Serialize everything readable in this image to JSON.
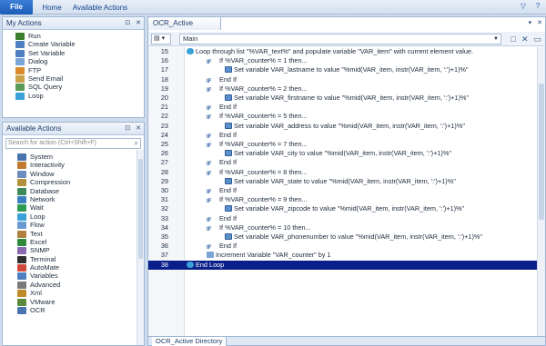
{
  "ribbon": {
    "tabs": [
      "File",
      "Home",
      "Available Actions"
    ],
    "right_icons": [
      "chevron-down-icon",
      "help-icon"
    ]
  },
  "my_actions": {
    "title": "My Actions",
    "items": [
      {
        "label": "Run",
        "icon": "run-icon",
        "color": "#3a7f2e"
      },
      {
        "label": "Create Variable",
        "icon": "create-variable-icon",
        "color": "#4f7fc0"
      },
      {
        "label": "Set Variable",
        "icon": "set-variable-icon",
        "color": "#4f7fc0"
      },
      {
        "label": "Dialog",
        "icon": "dialog-icon",
        "color": "#7aa6d6"
      },
      {
        "label": "FTP",
        "icon": "ftp-icon",
        "color": "#d98a2a"
      },
      {
        "label": "Send Email",
        "icon": "email-icon",
        "color": "#c9a24a"
      },
      {
        "label": "SQL Query",
        "icon": "sql-icon",
        "color": "#5c9a5c"
      },
      {
        "label": "Loop",
        "icon": "loop-icon",
        "color": "#3aa2d8"
      }
    ]
  },
  "available_actions": {
    "title": "Available Actions",
    "search_placeholder": "Search for action (Ctrl+Shift+F)",
    "items": [
      {
        "label": "System",
        "icon": "system-icon",
        "color": "#4a74b0"
      },
      {
        "label": "Interactivity",
        "icon": "interactivity-icon",
        "color": "#c27a2e"
      },
      {
        "label": "Window",
        "icon": "window-icon",
        "color": "#6c8cbf"
      },
      {
        "label": "Compression",
        "icon": "compression-icon",
        "color": "#b2913e"
      },
      {
        "label": "Database",
        "icon": "database-icon",
        "color": "#3f8a5a"
      },
      {
        "label": "Network",
        "icon": "network-icon",
        "color": "#3c7fc0"
      },
      {
        "label": "Wait",
        "icon": "wait-icon",
        "color": "#2e9a54"
      },
      {
        "label": "Loop",
        "icon": "loop-icon",
        "color": "#3aa2d8"
      },
      {
        "label": "Flow",
        "icon": "flow-icon",
        "color": "#6a9bd0"
      },
      {
        "label": "Text",
        "icon": "text-icon",
        "color": "#b08040"
      },
      {
        "label": "Excel",
        "icon": "excel-icon",
        "color": "#2f8a3a"
      },
      {
        "label": "SNMP",
        "icon": "snmp-icon",
        "color": "#8a6ab0"
      },
      {
        "label": "Terminal",
        "icon": "terminal-icon",
        "color": "#303030"
      },
      {
        "label": "AutoMate",
        "icon": "automate-icon",
        "color": "#d04a3a"
      },
      {
        "label": "Variables",
        "icon": "variables-icon",
        "color": "#4f7fc0"
      },
      {
        "label": "Advanced",
        "icon": "advanced-icon",
        "color": "#7a7a7a"
      },
      {
        "label": "Xml",
        "icon": "xml-icon",
        "color": "#c08a2a"
      },
      {
        "label": "VMware",
        "icon": "vmware-icon",
        "color": "#5a8a3a"
      },
      {
        "label": "OCR",
        "icon": "ocr-icon",
        "color": "#4a74b0"
      }
    ]
  },
  "editor": {
    "doc_tab": "OCR_Active Directory",
    "task_select": "Main",
    "bottom_tab": "OCR_Active Directory",
    "selected_color": "#0a1f8a",
    "rows": [
      {
        "num": "15",
        "indent": 0,
        "icon": "loop",
        "text": "Loop through list \"%VAR_text%\" and populate variable \"VAR_item\" with current element value."
      },
      {
        "num": "16",
        "indent": 1,
        "icon": "if",
        "text": "If %VAR_counter% = 1 then..."
      },
      {
        "num": "17",
        "indent": 2,
        "icon": "set",
        "text": "Set variable VAR_lastname to value \"%mid(VAR_item, instr(VAR_item, ':')+1)%\""
      },
      {
        "num": "18",
        "indent": 1,
        "icon": "if",
        "text": "End If"
      },
      {
        "num": "19",
        "indent": 1,
        "icon": "if",
        "text": "If %VAR_counter% = 2 then..."
      },
      {
        "num": "20",
        "indent": 2,
        "icon": "set",
        "text": "Set variable VAR_firstname to value \"%mid(VAR_item, instr(VAR_item, ':')+1)%\""
      },
      {
        "num": "21",
        "indent": 1,
        "icon": "if",
        "text": "End If"
      },
      {
        "num": "22",
        "indent": 1,
        "icon": "if",
        "text": "If %VAR_counter% = 5 then..."
      },
      {
        "num": "23",
        "indent": 2,
        "icon": "set",
        "text": "Set variable VAR_address to value \"%mid(VAR_item, instr(VAR_item, ':')+1)%\""
      },
      {
        "num": "24",
        "indent": 1,
        "icon": "if",
        "text": "End If"
      },
      {
        "num": "25",
        "indent": 1,
        "icon": "if",
        "text": "If %VAR_counter% = 7 then..."
      },
      {
        "num": "26",
        "indent": 2,
        "icon": "set",
        "text": "Set variable VAR_city to value \"%mid(VAR_item, instr(VAR_item, ':')+1)%\""
      },
      {
        "num": "27",
        "indent": 1,
        "icon": "if",
        "text": "End If"
      },
      {
        "num": "28",
        "indent": 1,
        "icon": "if",
        "text": "If %VAR_counter% = 8 then..."
      },
      {
        "num": "29",
        "indent": 2,
        "icon": "set",
        "text": "Set variable VAR_state to value \"%mid(VAR_item, instr(VAR_item, ':')+1)%\""
      },
      {
        "num": "30",
        "indent": 1,
        "icon": "if",
        "text": "End If"
      },
      {
        "num": "31",
        "indent": 1,
        "icon": "if",
        "text": "If %VAR_counter% = 9 then..."
      },
      {
        "num": "32",
        "indent": 2,
        "icon": "set",
        "text": "Set variable VAR_zipcode to value \"%mid(VAR_item, instr(VAR_item, ':')+1)%\""
      },
      {
        "num": "33",
        "indent": 1,
        "icon": "if",
        "text": "End If"
      },
      {
        "num": "34",
        "indent": 1,
        "icon": "if",
        "text": "If %VAR_counter% = 10 then..."
      },
      {
        "num": "35",
        "indent": 2,
        "icon": "set",
        "text": "Set variable VAR_phonenumber to value \"%mid(VAR_item, instr(VAR_item, ':')+1)%\""
      },
      {
        "num": "36",
        "indent": 1,
        "icon": "if",
        "text": "End If"
      },
      {
        "num": "37",
        "indent": 1,
        "icon": "inc",
        "text": "Increment Variable \"VAR_counter\" by 1"
      },
      {
        "num": "38",
        "indent": 0,
        "icon": "loop",
        "text": "End Loop",
        "selected": true
      }
    ]
  }
}
